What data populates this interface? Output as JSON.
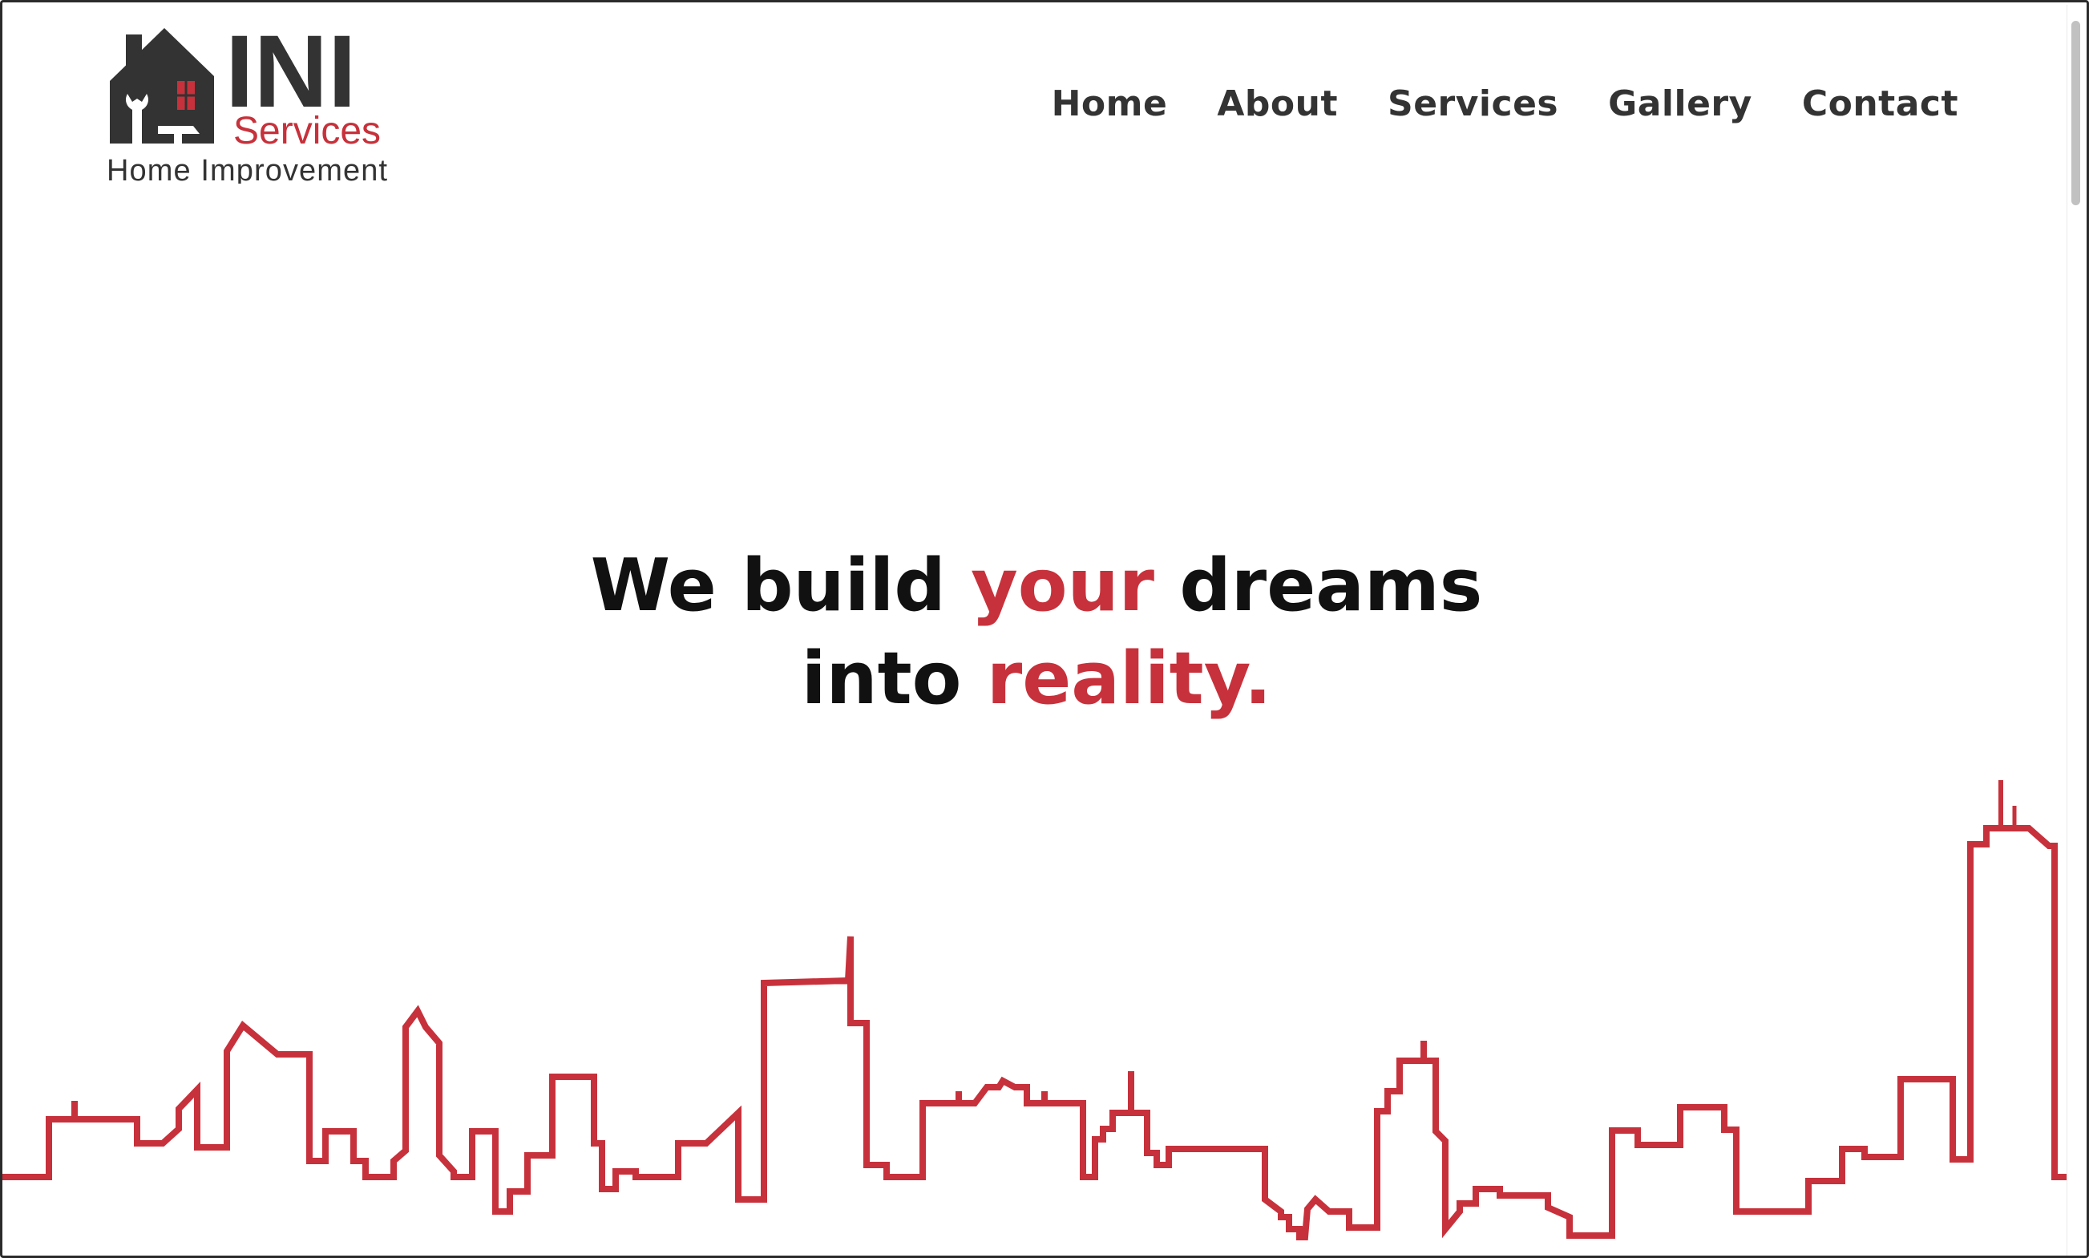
{
  "brand": {
    "logo_mark": "INI",
    "logo_services": "Services",
    "logo_tagline": "Home Improvement",
    "primary_color": "#333333",
    "accent_color": "#c7313b"
  },
  "nav": {
    "items": [
      {
        "label": "Home"
      },
      {
        "label": "About"
      },
      {
        "label": "Services"
      },
      {
        "label": "Gallery"
      },
      {
        "label": "Contact"
      }
    ]
  },
  "hero": {
    "line1_a": "We build ",
    "line1_accent": "your",
    "line1_b": " dreams",
    "line2_a": "into ",
    "line2_accent": "reality."
  },
  "decor": {
    "skyline_icon": "city-skyline-outline",
    "skyline_color": "#c7313b"
  }
}
